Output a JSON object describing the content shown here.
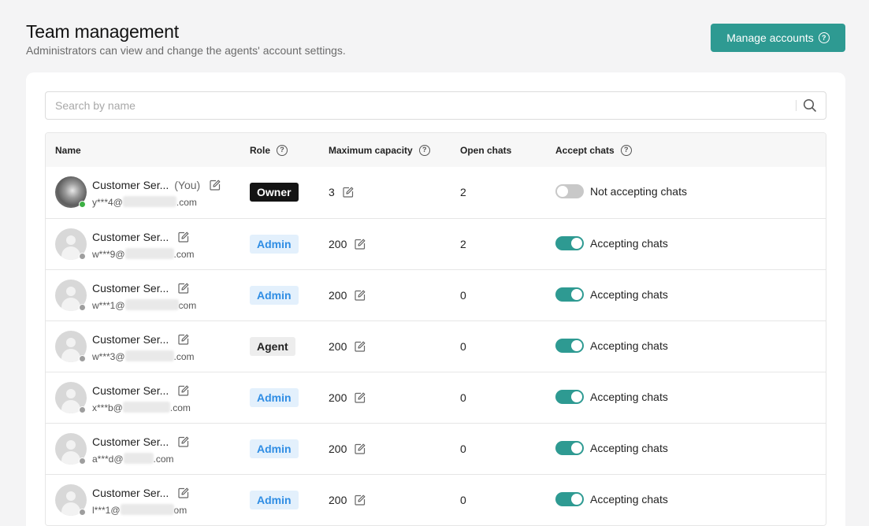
{
  "header": {
    "title": "Team management",
    "subtitle": "Administrators can view and change the agents' account settings.",
    "manage_button_label": "Manage accounts"
  },
  "search": {
    "placeholder": "Search by name",
    "value": ""
  },
  "table": {
    "columns": {
      "name": "Name",
      "role": "Role",
      "capacity": "Maximum capacity",
      "open_chats": "Open chats",
      "accept": "Accept chats"
    },
    "rows": [
      {
        "name": "Customer Ser...",
        "you": "(You)",
        "email_prefix": "y***4@",
        "email_suffix": ".com",
        "role": "Owner",
        "role_type": "owner",
        "capacity": "3",
        "open_chats": "2",
        "accepting": false,
        "accept_label": "Not accepting chats",
        "online": true,
        "photo": true
      },
      {
        "name": "Customer Ser...",
        "you": "",
        "email_prefix": "w***9@",
        "email_suffix": ".com",
        "role": "Admin",
        "role_type": "admin",
        "capacity": "200",
        "open_chats": "2",
        "accepting": true,
        "accept_label": "Accepting chats",
        "online": false,
        "photo": false
      },
      {
        "name": "Customer Ser...",
        "you": "",
        "email_prefix": "w***1@",
        "email_suffix": "com",
        "role": "Admin",
        "role_type": "admin",
        "capacity": "200",
        "open_chats": "0",
        "accepting": true,
        "accept_label": "Accepting chats",
        "online": false,
        "photo": false
      },
      {
        "name": "Customer Ser...",
        "you": "",
        "email_prefix": "w***3@",
        "email_suffix": ".com",
        "role": "Agent",
        "role_type": "agent",
        "capacity": "200",
        "open_chats": "0",
        "accepting": true,
        "accept_label": "Accepting chats",
        "online": false,
        "photo": false
      },
      {
        "name": "Customer Ser...",
        "you": "",
        "email_prefix": "x***b@",
        "email_suffix": ".com",
        "role": "Admin",
        "role_type": "admin",
        "capacity": "200",
        "open_chats": "0",
        "accepting": true,
        "accept_label": "Accepting chats",
        "online": false,
        "photo": false
      },
      {
        "name": "Customer Ser...",
        "you": "",
        "email_prefix": "a***d@",
        "email_suffix": ".com",
        "role": "Admin",
        "role_type": "admin",
        "capacity": "200",
        "open_chats": "0",
        "accepting": true,
        "accept_label": "Accepting chats",
        "online": false,
        "photo": false
      },
      {
        "name": "Customer Ser...",
        "you": "",
        "email_prefix": "l***1@",
        "email_suffix": "om",
        "role": "Admin",
        "role_type": "admin",
        "capacity": "200",
        "open_chats": "0",
        "accepting": true,
        "accept_label": "Accepting chats",
        "online": false,
        "photo": false
      }
    ]
  },
  "colors": {
    "accent": "#2e9a92",
    "owner_badge_bg": "#141414",
    "admin_badge_bg": "#e3f0fc",
    "admin_badge_text": "#2f8de4",
    "agent_badge_bg": "#ededed",
    "online_dot": "#3cb043"
  },
  "icons": {
    "manage_help": "help-circle-icon",
    "search": "search-icon",
    "edit": "edit-icon",
    "column_help": "help-circle-icon"
  }
}
